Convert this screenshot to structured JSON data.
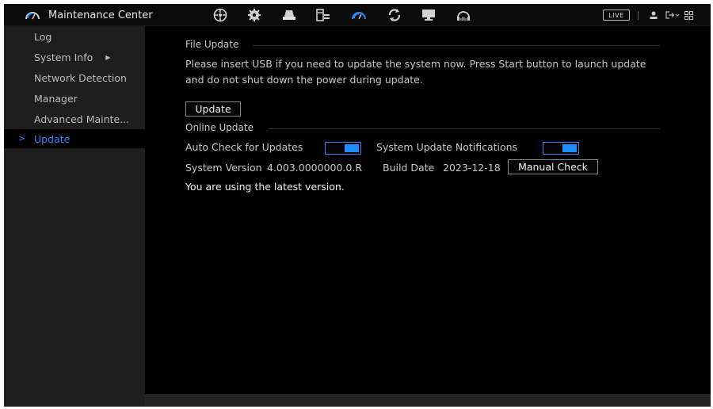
{
  "app": {
    "title": "Maintenance Center"
  },
  "topbar": {
    "nav_icons": [
      "network-icon",
      "settings-gear-icon",
      "storage-icon",
      "system-icon",
      "maintenance-icon",
      "refresh-icon",
      "display-icon",
      "audio-icon"
    ],
    "active_icon": "maintenance-icon",
    "live_label": "LIVE",
    "right_icons": [
      "user-icon",
      "logout-icon",
      "grid-icon"
    ]
  },
  "sidebar": {
    "items": [
      {
        "label": "Log"
      },
      {
        "label": "System Info",
        "has_submenu": true
      },
      {
        "label": "Network Detection"
      },
      {
        "label": "Manager"
      },
      {
        "label": "Advanced Mainte..."
      },
      {
        "label": "Update",
        "active": true,
        "marker": ">"
      }
    ]
  },
  "file_update": {
    "title": "File Update",
    "line1": "Please insert USB if you need to update the system now. Press Start button to launch update",
    "line2": "and do not shut down the power during update.",
    "update_button": "Update"
  },
  "online_update": {
    "title": "Online Update",
    "auto_check_label": "Auto Check for Updates",
    "auto_check_on": true,
    "notifications_label": "System Update Notifications",
    "notifications_on": true,
    "system_version_label": "System Version",
    "system_version_value": "4.003.0000000.0.R",
    "build_date_label": "Build Date",
    "build_date_value": "2023-12-18",
    "manual_check_button": "Manual Check",
    "status_message": "You are using the latest version."
  },
  "colors": {
    "accent": "#2f86ff",
    "sidebar_bg": "#1e1e1e",
    "content_bg": "#000000"
  }
}
